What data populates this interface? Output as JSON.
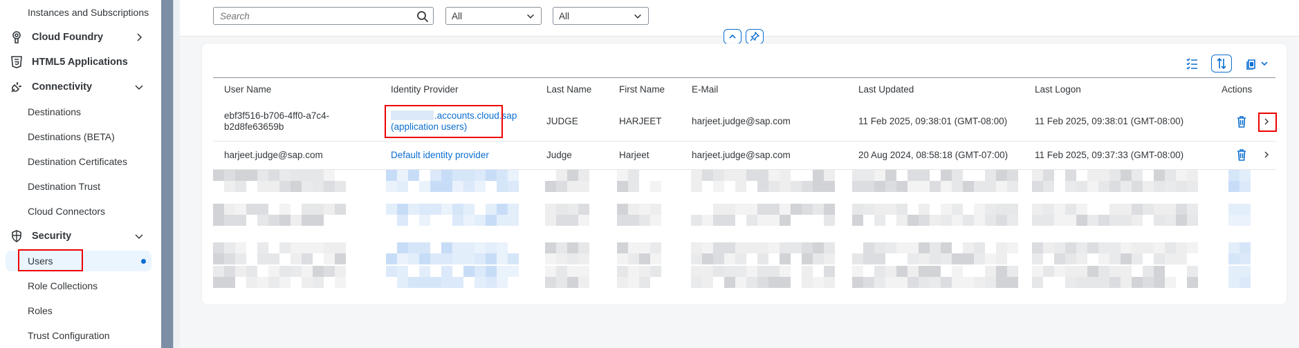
{
  "sidebar": {
    "items": [
      {
        "label": "Instances and Subscriptions"
      },
      {
        "label": "Cloud Foundry"
      },
      {
        "label": "HTML5 Applications"
      },
      {
        "label": "Connectivity"
      },
      {
        "label": "Destinations"
      },
      {
        "label": "Destinations (BETA)"
      },
      {
        "label": "Destination Certificates"
      },
      {
        "label": "Destination Trust"
      },
      {
        "label": "Cloud Connectors"
      },
      {
        "label": "Security"
      },
      {
        "label": "Users"
      },
      {
        "label": "Role Collections"
      },
      {
        "label": "Roles"
      },
      {
        "label": "Trust Configuration"
      }
    ]
  },
  "filters": {
    "search_placeholder": "Search",
    "filter1_value": "All",
    "filter2_value": "All"
  },
  "table": {
    "columns": [
      "User Name",
      "Identity Provider",
      "Last Name",
      "First Name",
      "E-Mail",
      "Last Updated",
      "Last Logon",
      "Actions"
    ],
    "rows": [
      {
        "user_name_line1": "ebf3f516-b706-4ff0-a7c4-",
        "user_name_line2": "b2d8fe63659b",
        "idp_line1": ".accounts.cloud.sap",
        "idp_line2": "(application users)",
        "last_name": "JUDGE",
        "first_name": "HARJEET",
        "email": "harjeet.judge@sap.com",
        "last_updated": "11 Feb 2025, 09:38:01 (GMT-08:00)",
        "last_logon": "11 Feb 2025, 09:38:01 (GMT-08:00)"
      },
      {
        "user_name": "harjeet.judge@sap.com",
        "idp": "Default identity provider",
        "last_name": "Judge",
        "first_name": "Harjeet",
        "email": "harjeet.judge@sap.com",
        "last_updated": "20 Aug 2024, 08:58:18 (GMT-07:00)",
        "last_logon": "11 Feb 2025, 09:37:33 (GMT-08:00)"
      }
    ]
  },
  "colors": {
    "accent": "#0a6ed1",
    "highlight": "#e00000",
    "sidebar_selected_bg": "#ebf5fe"
  }
}
